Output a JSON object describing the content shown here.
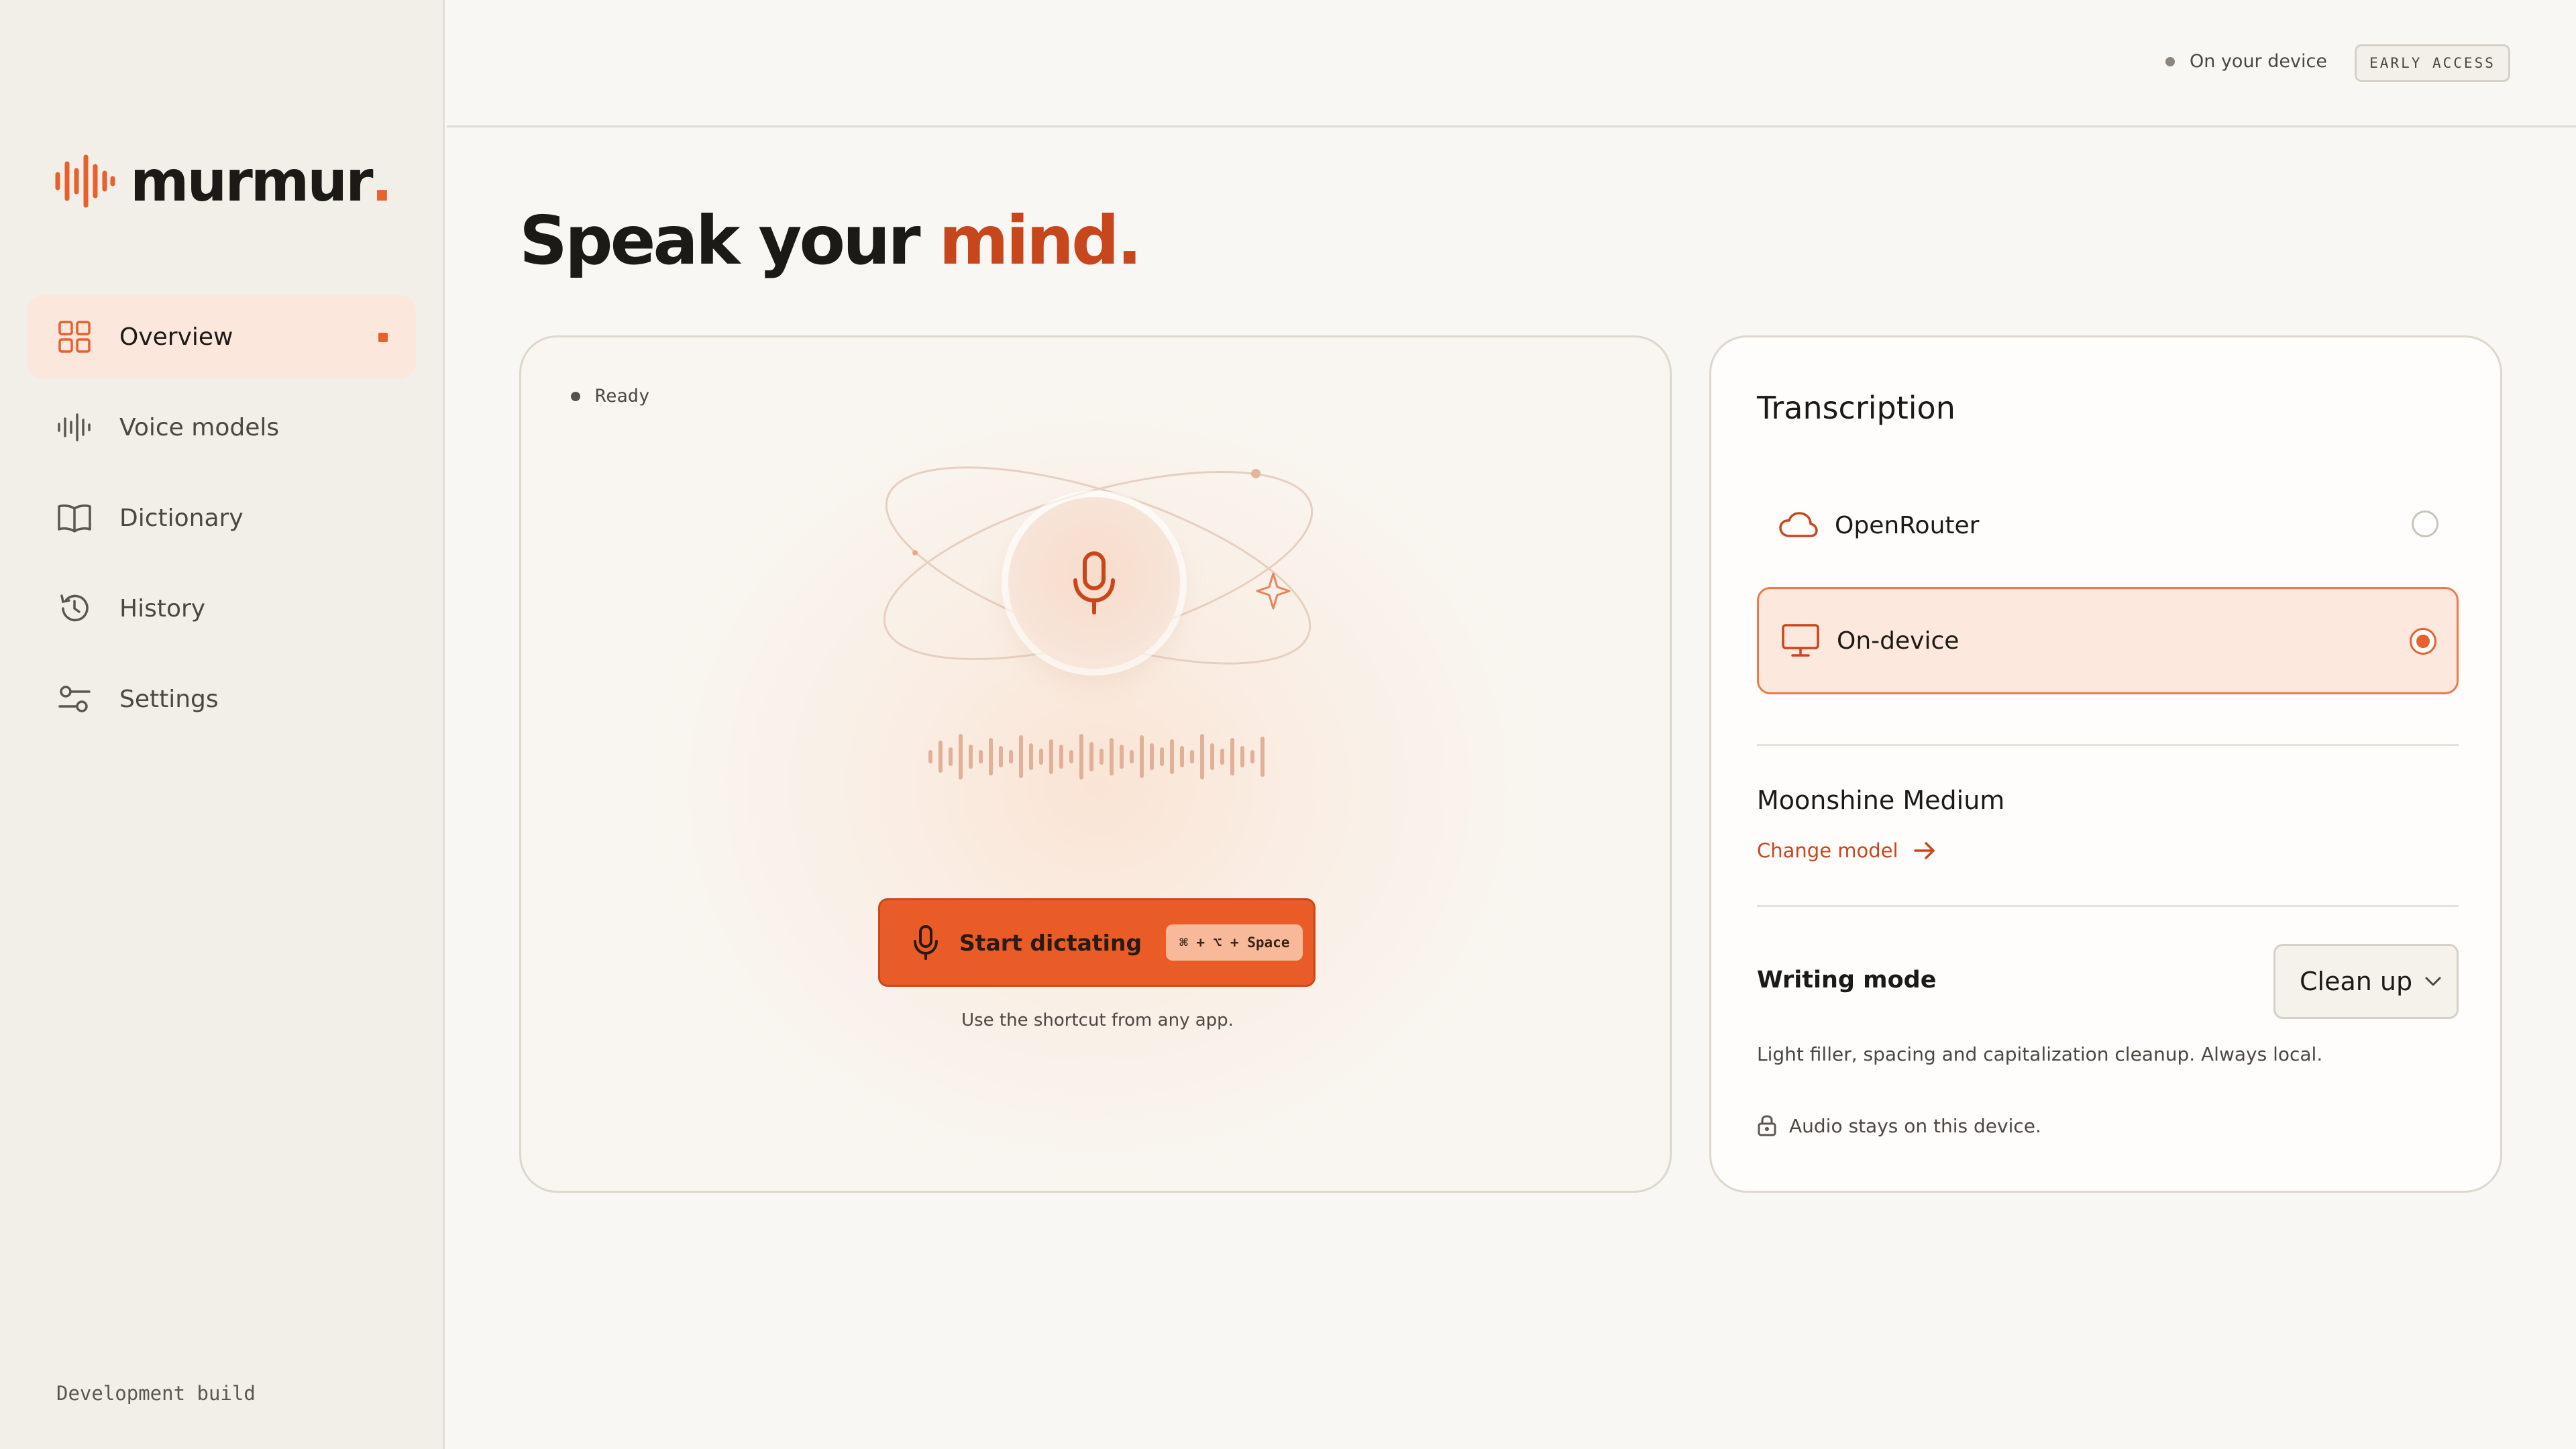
{
  "app": {
    "brand_name": "murmur",
    "brand_dot": ".",
    "accent_color": "#e8602c",
    "dev_build": "Development build"
  },
  "sidebar": {
    "items": [
      {
        "label": "Overview",
        "icon": "grid-icon",
        "active": true
      },
      {
        "label": "Voice models",
        "icon": "waveform-icon",
        "active": false
      },
      {
        "label": "Dictionary",
        "icon": "book-icon",
        "active": false
      },
      {
        "label": "History",
        "icon": "history-icon",
        "active": false
      },
      {
        "label": "Settings",
        "icon": "sliders-icon",
        "active": false
      }
    ]
  },
  "topbar": {
    "device_status": "On your device",
    "badge": "EARLY ACCESS"
  },
  "headline": {
    "prefix": "Speak your ",
    "accent": "mind."
  },
  "dictation": {
    "status": "Ready",
    "start_label": "Start dictating",
    "shortcut": "⌘ + ⌥ + Space",
    "hint": "Use the shortcut from any app."
  },
  "transcription": {
    "title": "Transcription",
    "options": [
      {
        "label": "OpenRouter",
        "icon": "cloud-icon",
        "selected": false
      },
      {
        "label": "On-device",
        "icon": "monitor-icon",
        "selected": true
      }
    ],
    "model_name": "Moonshine Medium",
    "change_model": "Change model",
    "writing_mode_label": "Writing mode",
    "writing_mode_value": "Clean up",
    "writing_mode_desc": "Light filler, spacing and capitalization cleanup. Always local.",
    "privacy_note": "Audio stays on this device."
  }
}
